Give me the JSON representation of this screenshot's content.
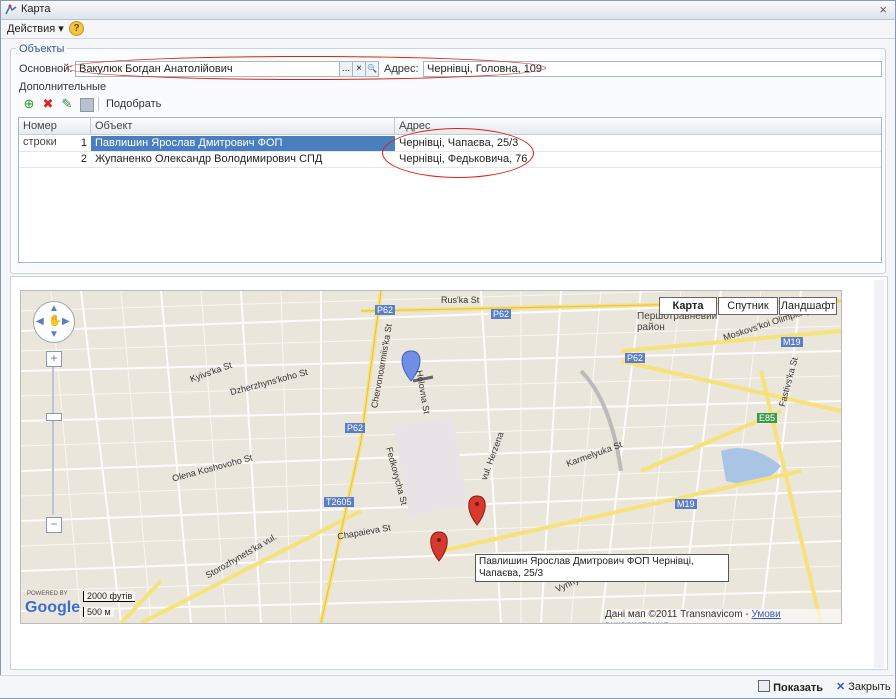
{
  "window": {
    "title": "Карта"
  },
  "menu": {
    "actions": "Действия",
    "help": "?"
  },
  "objects": {
    "group_title": "Объекты",
    "main_label": "Основной:",
    "main_value": "Вакулюк  Богдан Анатолійович",
    "address_label": "Адрес:",
    "address_value": "Чернівці, Головна, 109",
    "extra_label": "Дополнительные",
    "pick_label": "Подобрать",
    "dots": "...",
    "clear": "×",
    "search": "🔍"
  },
  "table": {
    "headers": [
      "Номер строки",
      "Объект",
      "Адрес"
    ],
    "rows": [
      {
        "num": "1",
        "object": "Павлишин Ярослав Дмитрович ФОП",
        "address": "Чернівці, Чапаєва, 25/3"
      },
      {
        "num": "2",
        "object": "Жупаненко Олександр Володимирович СПД",
        "address": "Чернівці, Федьковича, 76"
      }
    ]
  },
  "map": {
    "types": [
      "Карта",
      "Спутник",
      "Ландшафт"
    ],
    "streets": [
      "Rus'ka St",
      "Moskovs'koi Olimpiady St",
      "Chervonoarmiis'ka St",
      "Holovna St",
      "Kyivs'ka St",
      "Dzherzhyns'koho St",
      "Fastivs'ka St",
      "Karmelyuka St",
      "vul. Herzena",
      "Fedkovycha St",
      "Chapaieva St",
      "Vynnychenka St",
      "Olena Koshovoho St",
      "Storozhynets'ka vul."
    ],
    "route_labels": [
      "P62",
      "P62",
      "P62",
      "P62",
      "T2605",
      "M19",
      "M19",
      "E85"
    ],
    "district": "Першотравневий район",
    "copyright": "Дані мап ©2011 Transnavicom",
    "terms": "Умови використання",
    "scale_ft": "2000 футів",
    "scale_m": "500 м",
    "google": "Google",
    "powered": "POWERED BY",
    "tooltip": "Павлишин Ярослав Дмитрович ФОП Чернівці, Чапаєва, 25/3"
  },
  "footer": {
    "show": "Показать",
    "close": "Закрыть"
  },
  "colors": {
    "selected": "#4a7fbf",
    "marker_red": "#d63a2f",
    "marker_blue": "#6f8fe6",
    "road_yellow": "#f6e27a"
  }
}
